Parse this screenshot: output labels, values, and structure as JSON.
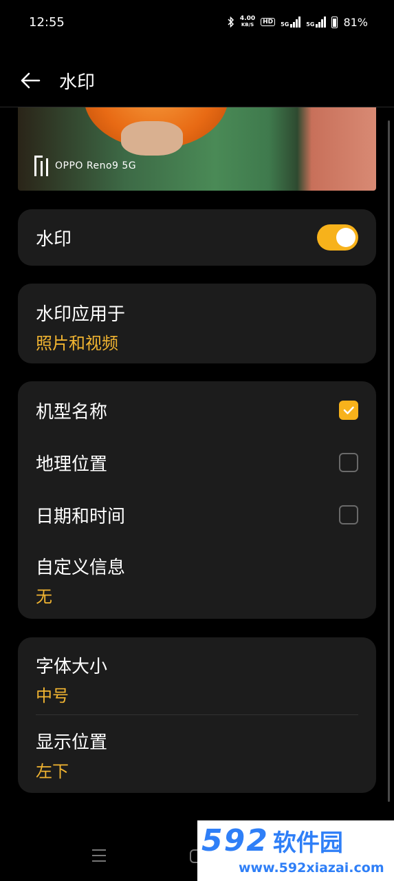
{
  "status_bar": {
    "time": "12:55",
    "net_speed": "4.00",
    "net_unit": "KB/S",
    "hd_label": "HD",
    "net1": "5G",
    "net2": "5G",
    "battery": "81%"
  },
  "header": {
    "title": "水印",
    "back_icon": "arrow-left-icon"
  },
  "preview": {
    "watermark_text": "OPPO Reno9 5G"
  },
  "watermark_card": {
    "label": "水印",
    "enabled": true
  },
  "apply_card": {
    "label": "水印应用于",
    "value": "照片和视频"
  },
  "info_card": {
    "items": [
      {
        "label": "机型名称",
        "checked": true
      },
      {
        "label": "地理位置",
        "checked": false
      },
      {
        "label": "日期和时间",
        "checked": false
      }
    ],
    "custom": {
      "label": "自定义信息",
      "value": "无"
    }
  },
  "style_card": {
    "font_size": {
      "label": "字体大小",
      "value": "中号"
    },
    "position": {
      "label": "显示位置",
      "value": "左下"
    }
  },
  "site_badge": {
    "num": "592",
    "name": "软件园",
    "url": "www.592xiazai.com"
  },
  "colors": {
    "accent": "#f7b21b",
    "accent_text": "#f2b531",
    "card": "#1c1c1c",
    "badge_blue": "#2f7ff7"
  }
}
